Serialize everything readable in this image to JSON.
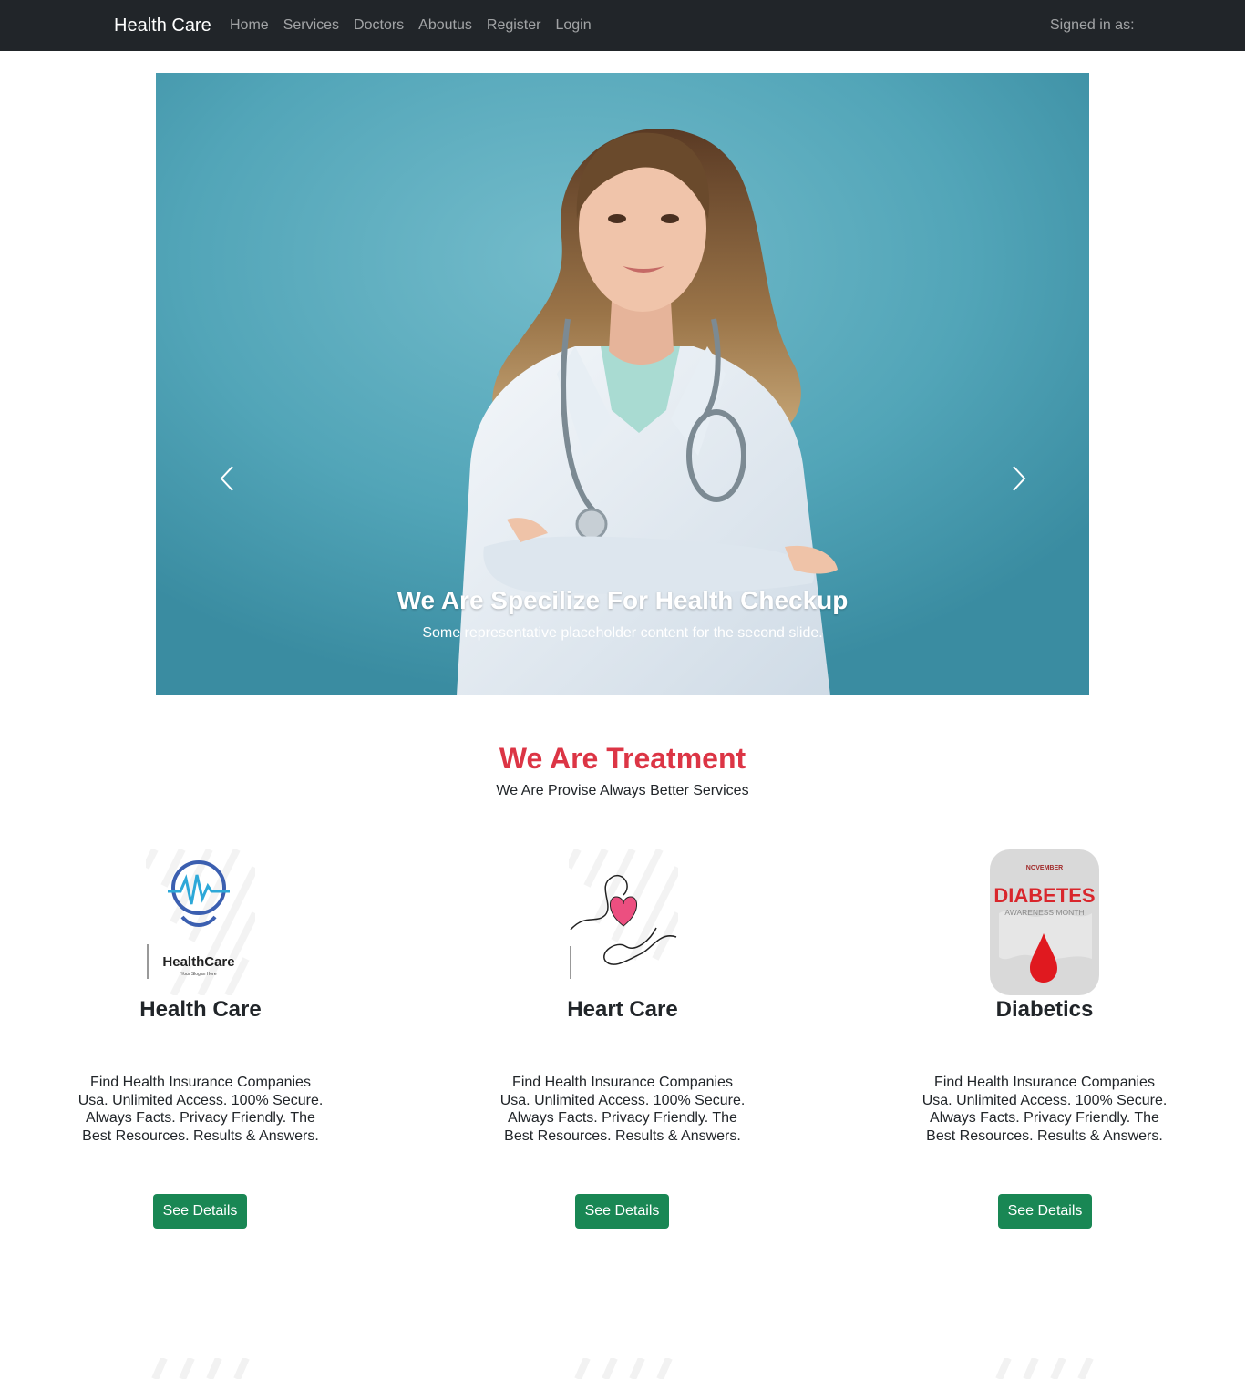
{
  "navbar": {
    "brand": "Health Care",
    "links": [
      "Home",
      "Services",
      "Doctors",
      "Aboutus",
      "Register",
      "Login"
    ],
    "signed_in": "Signed in as:"
  },
  "carousel": {
    "title": "We Are Specilize For Health Checkup",
    "text": "Some representative placeholder content for the second slide.",
    "prev_icon": "chevron-left-icon",
    "next_icon": "chevron-right-icon"
  },
  "section": {
    "title": "We Are Treatment",
    "subtitle": "We Are Provise Always Better Services"
  },
  "services": [
    {
      "title": "Health Care",
      "image_icon": "health-care-logo",
      "logo_text": "HealthCare",
      "logo_slogan": "Your Slogan Here",
      "description": "Find Health Insurance Companies Usa. Unlimited Access. 100% Secure. Always Facts. Privacy Friendly. The Best Resources. Results & Answers.",
      "button": "See Details"
    },
    {
      "title": "Heart Care",
      "image_icon": "heart-hands-icon",
      "description": "Find Health Insurance Companies Usa. Unlimited Access. 100% Secure. Always Facts. Privacy Friendly. The Best Resources. Results & Answers.",
      "button": "See Details"
    },
    {
      "title": "Diabetics",
      "image_icon": "diabetes-awareness-icon",
      "badge_month": "NOVEMBER",
      "badge_title": "DIABETES",
      "badge_sub": "AWARENESS MONTH",
      "description": "Find Health Insurance Companies Usa. Unlimited Access. 100% Secure. Always Facts. Privacy Friendly. The Best Resources. Results & Answers.",
      "button": "See Details"
    }
  ],
  "colors": {
    "navbar_bg": "#212529",
    "accent_red": "#dc3545",
    "button_green": "#198754",
    "carousel_bg": "#4fa3b7"
  }
}
